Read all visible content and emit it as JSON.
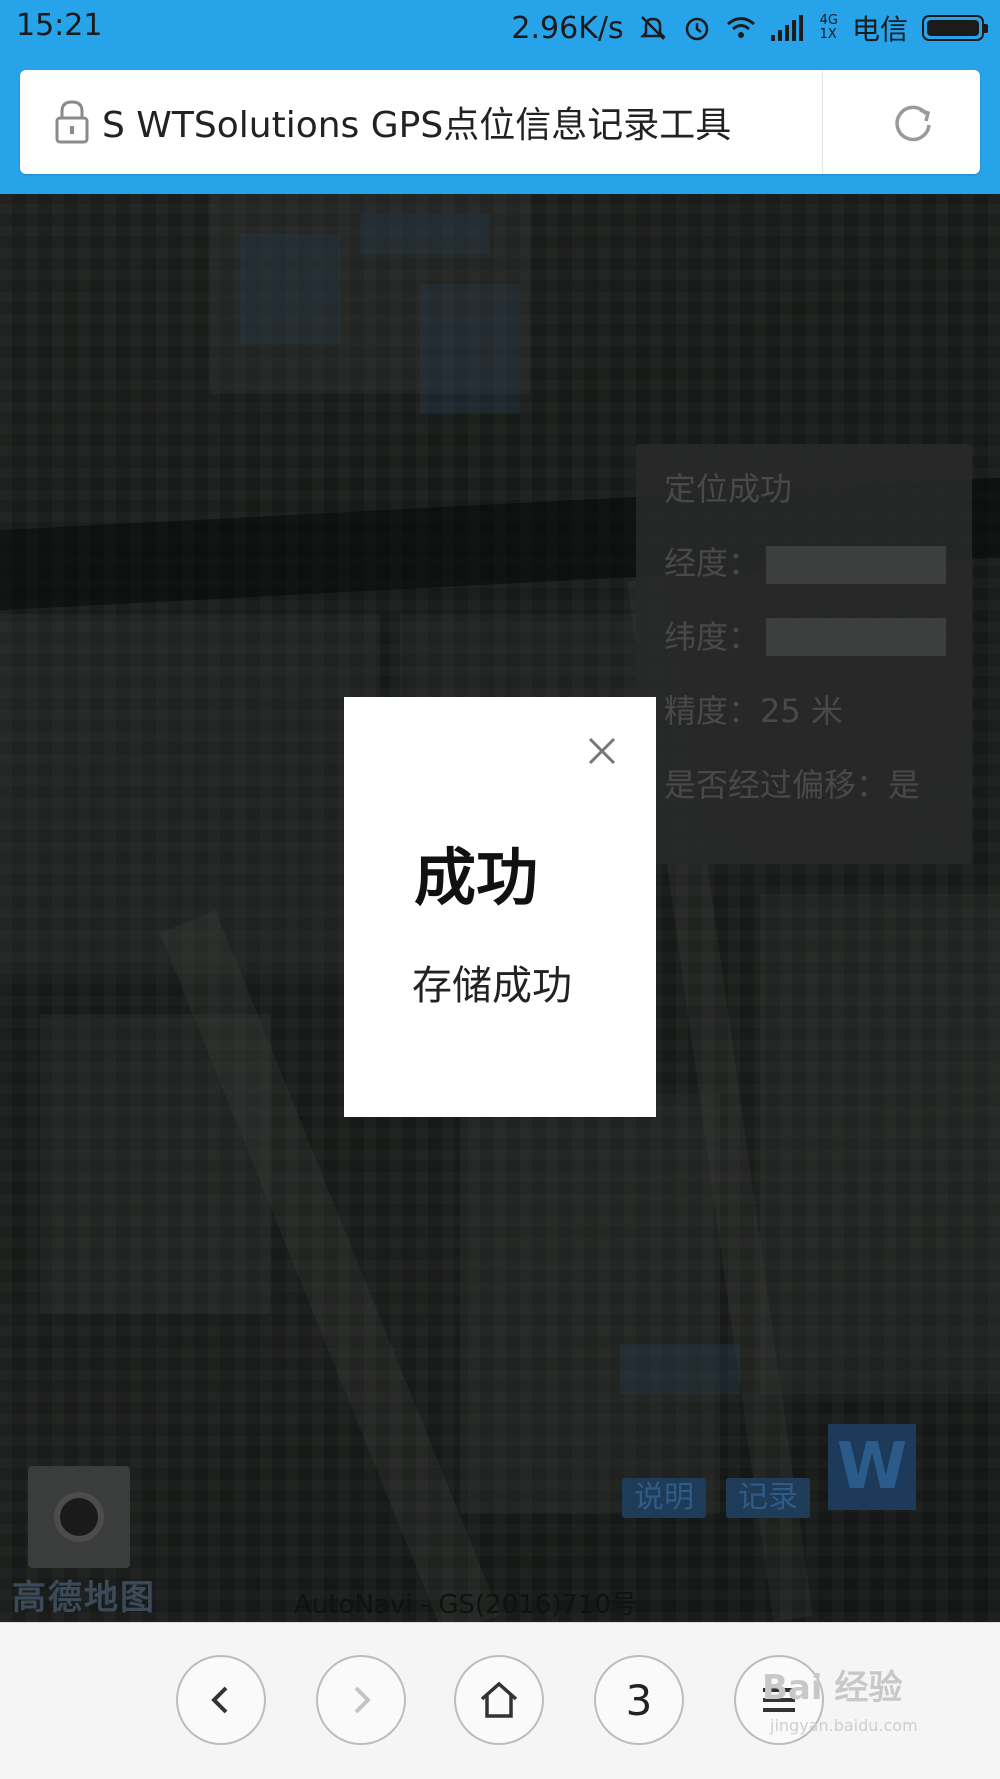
{
  "status_bar": {
    "time": "15:21",
    "network_speed": "2.96K/s",
    "network_type_top": "4G",
    "network_type_bottom": "1X",
    "carrier": "电信"
  },
  "address_bar": {
    "title": "S WTSolutions GPS点位信息记录工具"
  },
  "info_panel": {
    "status": "定位成功",
    "longitude_label": "经度：",
    "latitude_label": "纬度：",
    "accuracy": "精度：25 米",
    "offset": "是否经过偏移：是"
  },
  "map_buttons": {
    "help_label": "说明",
    "records_label": "记录",
    "w_logo": "W"
  },
  "map_footer": {
    "provider_logo": "高德地图",
    "copyright": "AutoNavi - GS(2016)710号"
  },
  "modal": {
    "title": "成功",
    "message": "存储成功"
  },
  "bottom_nav": {
    "tab_count": "3"
  },
  "watermark": {
    "main": "Bai 经验",
    "sub": "jingyan.baidu.com"
  },
  "colors": {
    "topbar": "#27a3ea",
    "modal_bg": "#ffffff"
  }
}
